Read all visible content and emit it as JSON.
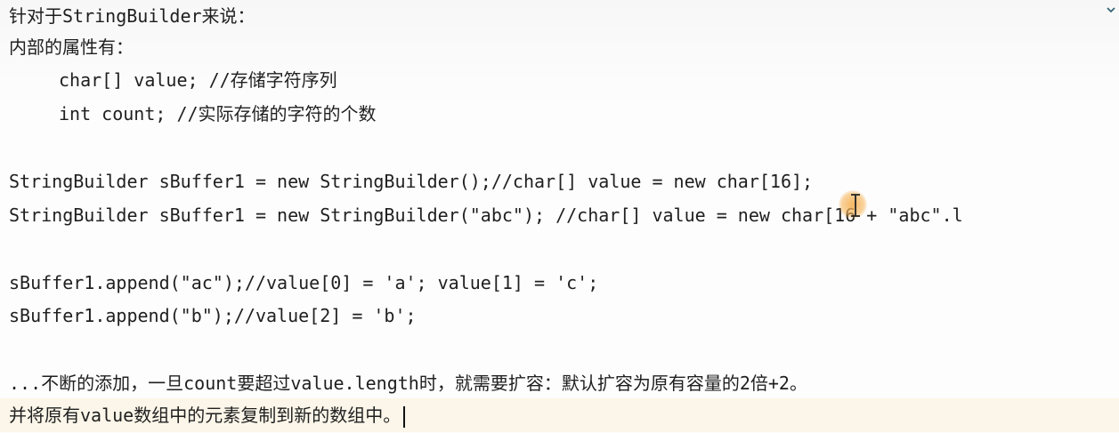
{
  "lines": [
    "针对于StringBuilder来说：",
    "内部的属性有：",
    "char[] value; //存储字符序列",
    "int count; //实际存储的字符的个数",
    "",
    "StringBuilder sBuffer1 = new StringBuilder();//char[] value = new char[16];",
    "StringBuilder sBuffer1 = new StringBuilder(\"abc\"); //char[] value = new char[16 + \"abc\".l",
    "",
    "sBuffer1.append(\"ac\");//value[0] = 'a'; value[1] = 'c';",
    "sBuffer1.append(\"b\");//value[2] = 'b';",
    "",
    "...不断的添加，一旦count要超过value.length时，就需要扩容：默认扩容为原有容量的2倍+2。",
    "并将原有value数组中的元素复制到新的数组中。"
  ],
  "icons": {
    "scroll_chevron": "chevron-down-icon",
    "mouse_cursor": "text-cursor-icon"
  },
  "colors": {
    "text": "#1f1f1f",
    "current_line": "#fbf6e9",
    "cursor_highlight": "#f6b050"
  }
}
